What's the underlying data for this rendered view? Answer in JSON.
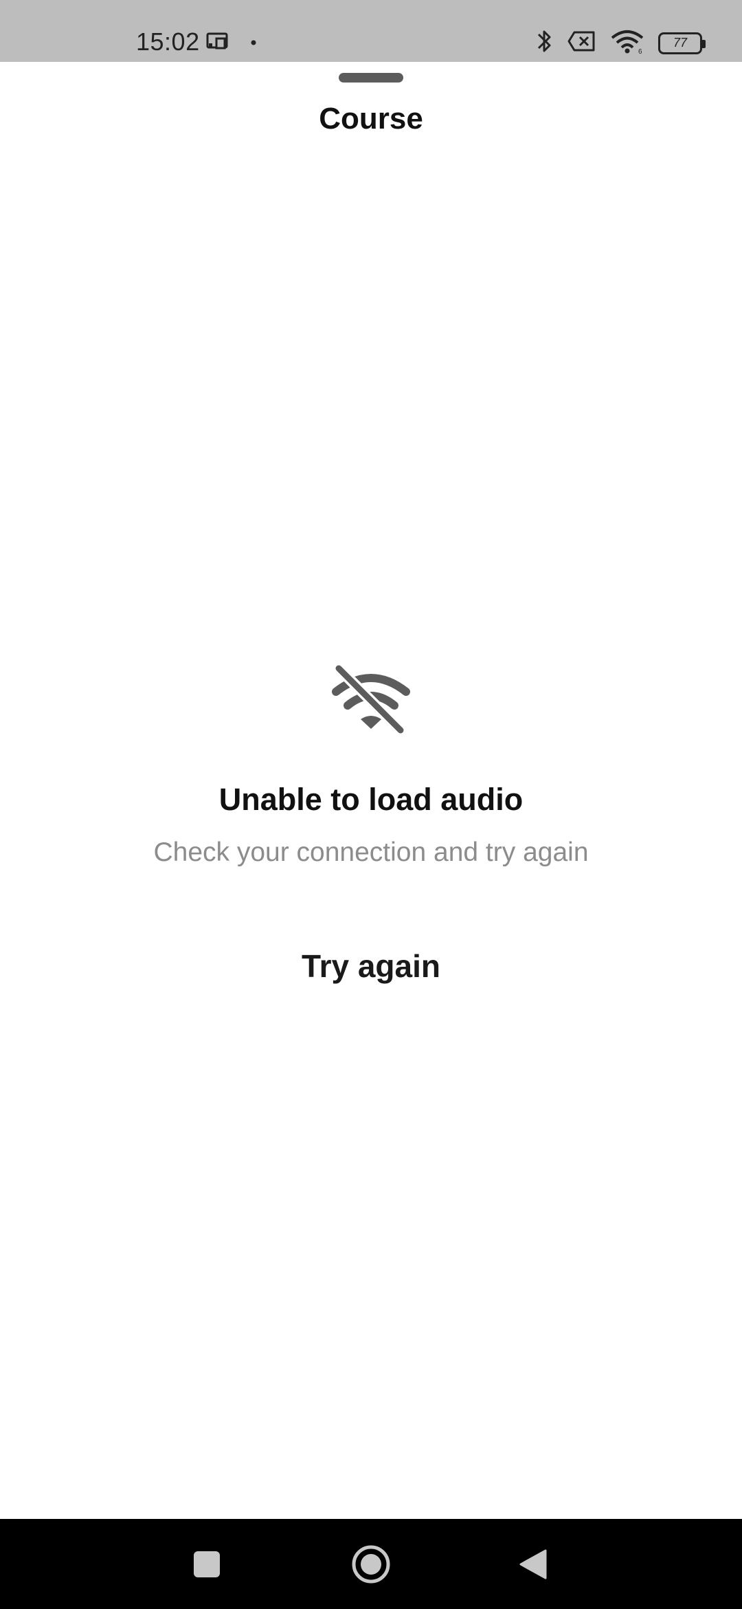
{
  "status_bar": {
    "time": "15:02",
    "battery_level": "77",
    "icons": [
      "screen-cast-icon",
      "notification-dot-icon",
      "bluetooth-icon",
      "sim-error-icon",
      "wifi-icon",
      "battery-icon"
    ]
  },
  "header": {
    "title": "Course"
  },
  "error": {
    "icon": "wifi-off-icon",
    "title": "Unable to load audio",
    "subtitle": "Check your connection and try again",
    "retry_label": "Try again"
  },
  "nav_bar": {
    "buttons": [
      "recents-button",
      "home-button",
      "back-button"
    ]
  },
  "colors": {
    "status_bar_bg": "#bdbdbd",
    "text_primary": "#111111",
    "text_secondary": "#8c8c8c",
    "icon_gray": "#5c5c5c",
    "nav_bar_bg": "#000000",
    "nav_icon": "#c8c8c8"
  }
}
